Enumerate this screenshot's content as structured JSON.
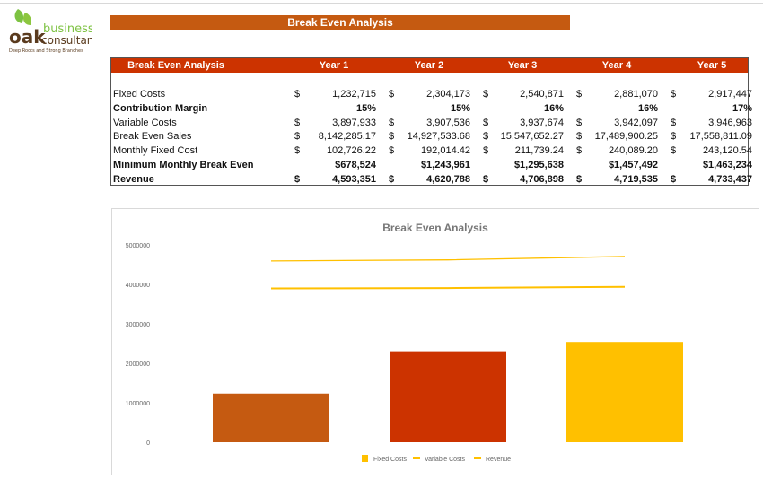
{
  "logo": {
    "text": "oak business consultant",
    "tagline": "Deep Roots and Strong Branches"
  },
  "banner": "Break Even Analysis",
  "table": {
    "header": [
      "Break Even Analysis",
      "Year 1",
      "Year 2",
      "Year 3",
      "Year 4",
      "Year 5"
    ],
    "rows": [
      {
        "label": "Fixed Costs",
        "bold": false,
        "dollar": true,
        "values": [
          "1,232,715",
          "2,304,173",
          "2,540,871",
          "2,881,070",
          "2,917,447"
        ]
      },
      {
        "label": "Contribution Margin",
        "bold": true,
        "dollar": false,
        "values": [
          "15%",
          "15%",
          "16%",
          "16%",
          "17%"
        ]
      },
      {
        "label": "Variable Costs",
        "bold": false,
        "dollar": true,
        "values": [
          "3,897,933",
          "3,907,536",
          "3,937,674",
          "3,942,097",
          "3,946,963"
        ]
      },
      {
        "label": "Break Even Sales",
        "bold": false,
        "dollar": true,
        "values": [
          "8,142,285.17",
          "14,927,533.68",
          "15,547,652.27",
          "17,489,900.25",
          "17,558,811.09"
        ]
      },
      {
        "label": "Monthly Fixed Cost",
        "bold": false,
        "dollar": true,
        "values": [
          "102,726.22",
          "192,014.42",
          "211,739.24",
          "240,089.20",
          "243,120.54"
        ]
      },
      {
        "label": "Minimum Monthly Break Even",
        "bold": true,
        "dollar": false,
        "values": [
          "$678,524",
          "$1,243,961",
          "$1,295,638",
          "$1,457,492",
          "$1,463,234"
        ]
      },
      {
        "label": "Revenue",
        "bold": true,
        "dollar": true,
        "values": [
          "4,593,351",
          "4,620,788",
          "4,706,898",
          "4,719,535",
          "4,733,437"
        ]
      }
    ],
    "currency": "$"
  },
  "chart_data": {
    "type": "bar",
    "title": "Break Even Analysis",
    "ylim": [
      0,
      5000000
    ],
    "yticks": [
      "0",
      "1000000",
      "2000000",
      "3000000",
      "4000000",
      "5000000"
    ],
    "grid": false,
    "legend_placement": "bottom",
    "bar_colors": [
      "#c55a11",
      "#cc3300",
      "#ffc000"
    ],
    "series": [
      {
        "name": "Fixed Costs",
        "kind": "bar",
        "values": [
          1232715,
          2304173,
          2540871
        ],
        "color": "#ffc000"
      },
      {
        "name": "Variable Costs",
        "kind": "line",
        "values": [
          3897933,
          3907536,
          3937674
        ],
        "color": "#ffc000"
      },
      {
        "name": "Revenue",
        "kind": "line",
        "values": [
          4593351,
          4620788,
          4706898
        ],
        "color": "#ffc000"
      }
    ]
  }
}
